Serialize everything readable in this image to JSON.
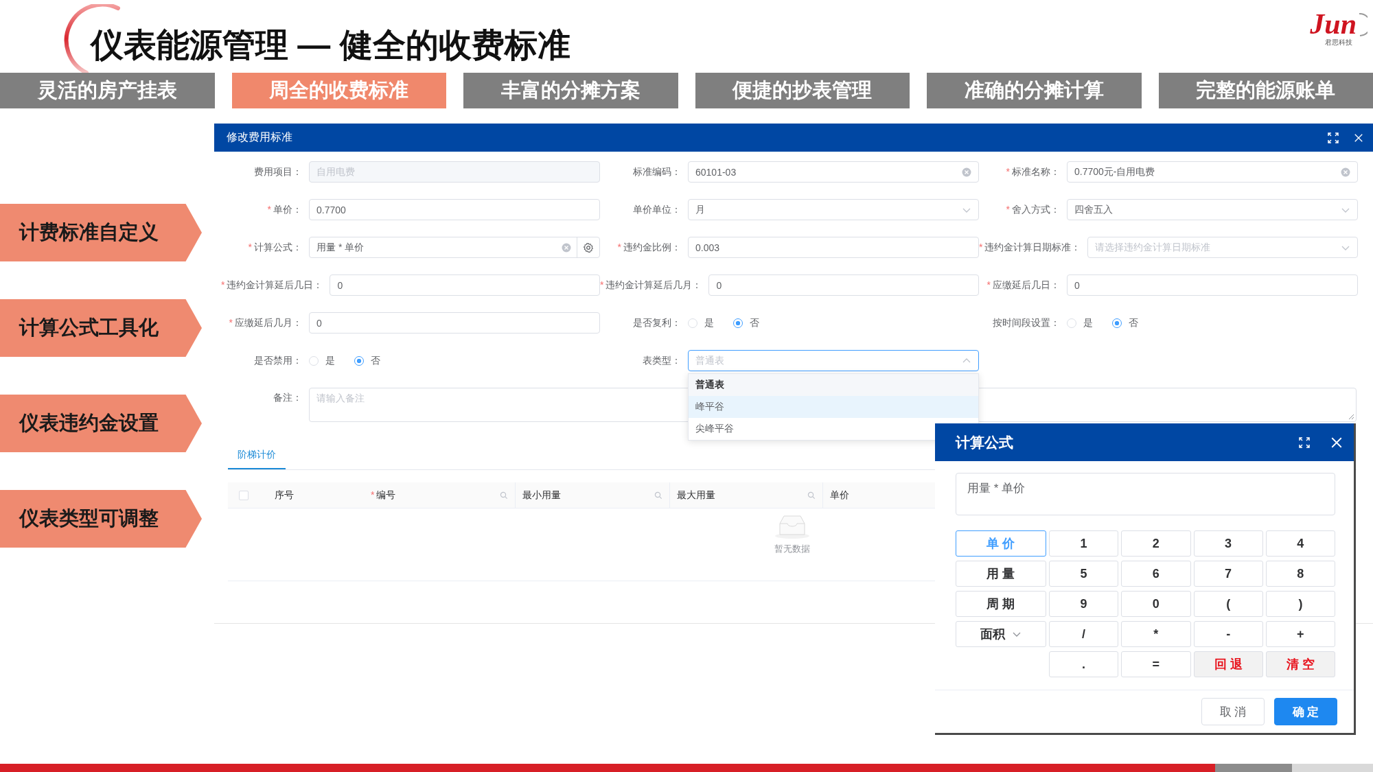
{
  "slide": {
    "title": "仪表能源管理 — 健全的收费标准",
    "logo": "Jun",
    "logo_caption": "君思科技"
  },
  "section_tabs": [
    {
      "label": "灵活的房产挂表",
      "selected": false
    },
    {
      "label": "周全的收费标准",
      "selected": true
    },
    {
      "label": "丰富的分摊方案",
      "selected": false
    },
    {
      "label": "便捷的抄表管理",
      "selected": false
    },
    {
      "label": "准确的分摊计算",
      "selected": false
    },
    {
      "label": "完整的能源账单",
      "selected": false
    }
  ],
  "feature_labels": [
    "计费标准自定义",
    "计算公式工具化",
    "仪表违约金设置",
    "仪表类型可调整"
  ],
  "fee_dialog": {
    "title": "修改费用标准",
    "rows": [
      [
        {
          "kind": "input",
          "label": "费用项目：",
          "value": "自用电费",
          "disabled": true,
          "clearable": false
        },
        {
          "kind": "input",
          "label": "标准编码：",
          "value": "60101-03",
          "disabled": false,
          "clearable": true
        },
        {
          "kind": "input",
          "label": "标准名称：",
          "required_mark": "*",
          "value": "0.7700元-自用电费",
          "disabled": false,
          "clearable": true
        }
      ],
      [
        {
          "kind": "input",
          "label": "单价：",
          "required_mark": "*",
          "value": "0.7700",
          "disabled": false,
          "clearable": false
        },
        {
          "kind": "select",
          "label": "单价单位：",
          "value": "月",
          "open": false
        },
        {
          "kind": "select",
          "label": "舍入方式：",
          "required_mark": "*",
          "value": "四舍五入",
          "open": false
        }
      ],
      [
        {
          "kind": "formula",
          "label": "计算公式：",
          "required_mark": "*",
          "value": "用量 * 单价"
        },
        {
          "kind": "input",
          "label": "违约金比例：",
          "required_mark": "*",
          "value": "0.003",
          "disabled": false,
          "clearable": false
        },
        {
          "kind": "select",
          "label": "违约金计算日期标准：",
          "required_mark": "*",
          "placeholder": "请选择违约金计算日期标准",
          "open": false
        }
      ],
      [
        {
          "kind": "input",
          "label": "违约金计算延后几日：",
          "required_mark": "*",
          "value": "0",
          "disabled": false,
          "clearable": false
        },
        {
          "kind": "input",
          "label": "违约金计算延后几月：",
          "required_mark": "*",
          "value": "0",
          "disabled": false,
          "clearable": false
        },
        {
          "kind": "input",
          "label": "应缴延后几日：",
          "required_mark": "*",
          "value": "0",
          "disabled": false,
          "clearable": false
        }
      ],
      [
        {
          "kind": "input",
          "label": "应缴延后几月：",
          "required_mark": "*",
          "value": "0",
          "disabled": false,
          "clearable": false
        },
        {
          "kind": "radio",
          "label": "是否复利：",
          "options": [
            {
              "label": "是",
              "selected": false
            },
            {
              "label": "否",
              "selected": true
            }
          ]
        },
        {
          "kind": "radio",
          "label": "按时间段设置：",
          "options": [
            {
              "label": "是",
              "selected": false
            },
            {
              "label": "否",
              "selected": true
            }
          ]
        }
      ],
      [
        {
          "kind": "radio",
          "label": "是否禁用：",
          "options": [
            {
              "label": "是",
              "selected": false
            },
            {
              "label": "否",
              "selected": true
            }
          ]
        },
        {
          "kind": "select",
          "label": "表类型：",
          "placeholder": "普通表",
          "open": true,
          "options": [
            {
              "label": "普通表",
              "selected": true,
              "hovered": false
            },
            {
              "label": "峰平谷",
              "selected": false,
              "hovered": true
            },
            {
              "label": "尖峰平谷",
              "selected": false,
              "hovered": false
            }
          ]
        }
      ],
      [
        {
          "kind": "textarea",
          "label": "备注：",
          "placeholder": "请输入备注"
        }
      ]
    ],
    "tabs": [
      {
        "label": "阶梯计价",
        "selected": true
      }
    ],
    "table": {
      "select_all": {
        "checked": false
      },
      "columns": [
        {
          "label": "序号",
          "searchable": false
        },
        {
          "label": "编号",
          "required_mark": "*",
          "searchable": true
        },
        {
          "label": "最小用量",
          "searchable": true
        },
        {
          "label": "最大用量",
          "searchable": true
        },
        {
          "label": "单价",
          "searchable": false
        }
      ],
      "empty_text": "暂无数据"
    }
  },
  "formula_dialog": {
    "title": "计算公式",
    "expression": "用量 * 单价",
    "variables": [
      {
        "label": "单 价",
        "kind": "button",
        "selected": true
      },
      {
        "label": "用 量",
        "kind": "button",
        "selected": false
      },
      {
        "label": "周 期",
        "kind": "button",
        "selected": false
      },
      {
        "label": "面积",
        "kind": "select",
        "selected": false
      }
    ],
    "keys": [
      {
        "label": "1",
        "kind": "input"
      },
      {
        "label": "2",
        "kind": "input"
      },
      {
        "label": "3",
        "kind": "input"
      },
      {
        "label": "4",
        "kind": "input"
      },
      {
        "label": "5",
        "kind": "input"
      },
      {
        "label": "6",
        "kind": "input"
      },
      {
        "label": "7",
        "kind": "input"
      },
      {
        "label": "8",
        "kind": "input"
      },
      {
        "label": "9",
        "kind": "input"
      },
      {
        "label": "0",
        "kind": "input"
      },
      {
        "label": "(",
        "kind": "input"
      },
      {
        "label": ")",
        "kind": "input"
      },
      {
        "label": "/",
        "kind": "input"
      },
      {
        "label": "*",
        "kind": "input"
      },
      {
        "label": "-",
        "kind": "input"
      },
      {
        "label": "+",
        "kind": "input"
      },
      {
        "label": ".",
        "kind": "input"
      },
      {
        "label": "=",
        "kind": "input"
      },
      {
        "label": "回 退",
        "kind": "action"
      },
      {
        "label": "清 空",
        "kind": "action"
      }
    ],
    "buttons": [
      {
        "label": "取 消",
        "kind": "default"
      },
      {
        "label": "确 定",
        "kind": "primary"
      }
    ]
  }
}
